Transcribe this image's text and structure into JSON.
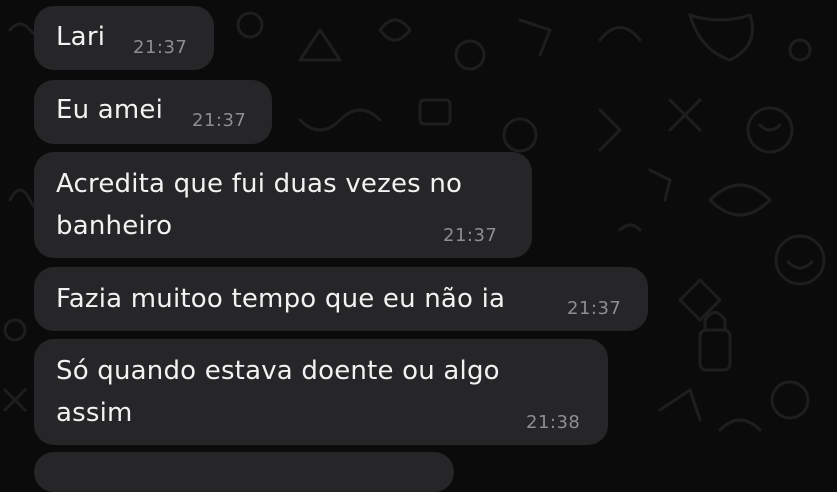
{
  "messages": [
    {
      "text": "Lari",
      "time": "21:37"
    },
    {
      "text": "Eu amei",
      "time": "21:37"
    },
    {
      "lines": [
        "Acredita que fui duas vezes no",
        "banheiro"
      ],
      "time": "21:37"
    },
    {
      "text": "Fazia muitoo tempo que eu não ia",
      "time": "21:37"
    },
    {
      "lines": [
        "Só quando estava doente ou algo",
        "assim"
      ],
      "time": "21:38"
    }
  ],
  "colors": {
    "background": "#0b0b0b",
    "bubble": "#262628",
    "text": "#f2f2f2",
    "timestamp": "#8d8d92",
    "doodle": "#1c1c1c"
  }
}
